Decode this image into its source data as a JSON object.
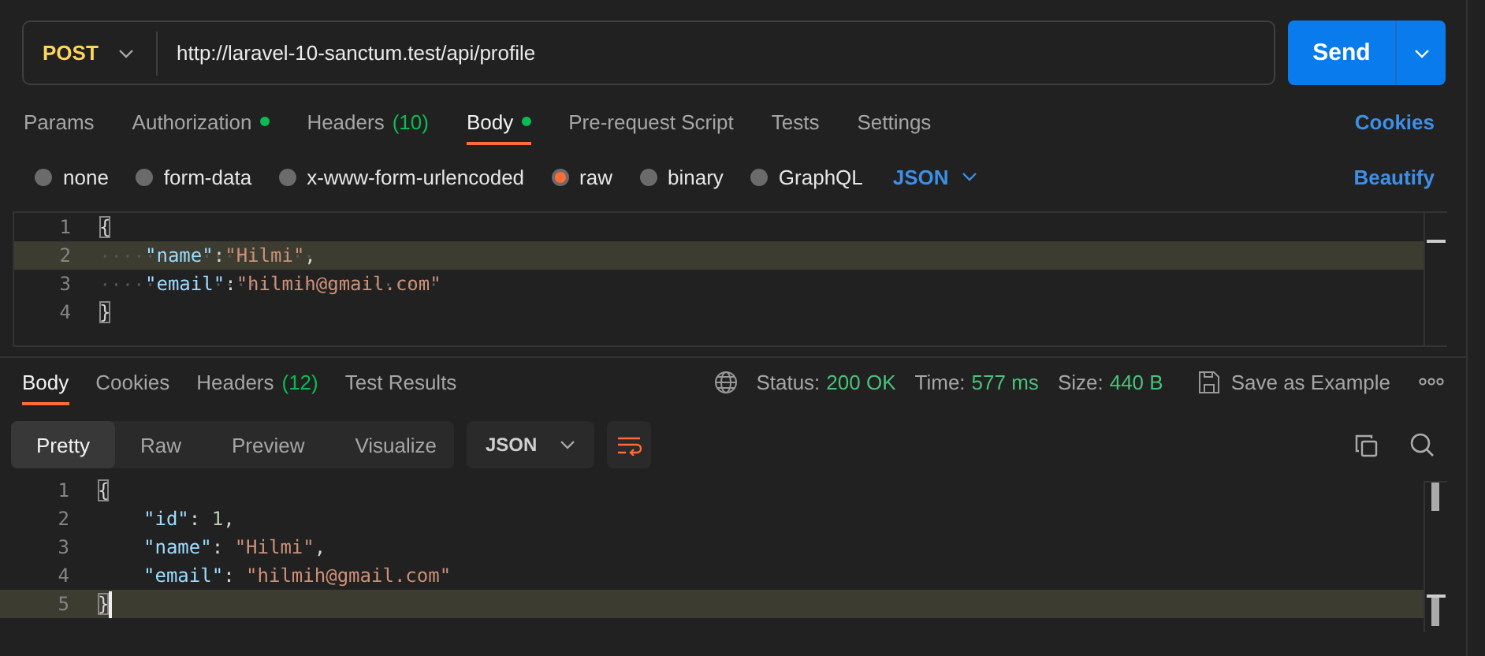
{
  "request": {
    "method": "POST",
    "url": "http://laravel-10-sanctum.test/api/profile",
    "send_label": "Send"
  },
  "request_tabs": [
    {
      "label": "Params",
      "selected": false,
      "dot": false
    },
    {
      "label": "Authorization",
      "selected": false,
      "dot": true
    },
    {
      "label": "Headers",
      "count": "(10)",
      "selected": false,
      "dot": false
    },
    {
      "label": "Body",
      "selected": true,
      "dot": true
    },
    {
      "label": "Pre-request Script",
      "selected": false,
      "dot": false
    },
    {
      "label": "Tests",
      "selected": false,
      "dot": false
    },
    {
      "label": "Settings",
      "selected": false,
      "dot": false
    }
  ],
  "cookies_link": "Cookies",
  "body_types": [
    {
      "label": "none",
      "selected": false
    },
    {
      "label": "form-data",
      "selected": false
    },
    {
      "label": "x-www-form-urlencoded",
      "selected": false
    },
    {
      "label": "raw",
      "selected": true
    },
    {
      "label": "binary",
      "selected": false
    },
    {
      "label": "GraphQL",
      "selected": false
    }
  ],
  "body_format": "JSON",
  "beautify_link": "Beautify",
  "request_body": {
    "show_whitespace": true,
    "lines": [
      {
        "number": "1",
        "indented": false,
        "highlighted": false,
        "cursor": false,
        "tokens": [
          {
            "kind": "brace",
            "text": "{",
            "matched": true
          }
        ]
      },
      {
        "number": "2",
        "indented": true,
        "highlighted": true,
        "cursor": false,
        "tokens": [
          {
            "kind": "key",
            "text": "\"name\""
          },
          {
            "kind": "punct",
            "text": ":"
          },
          {
            "kind": "string",
            "text": "\"Hilmi\""
          },
          {
            "kind": "punct",
            "text": ","
          }
        ]
      },
      {
        "number": "3",
        "indented": true,
        "highlighted": false,
        "cursor": false,
        "tokens": [
          {
            "kind": "key",
            "text": "\"email\""
          },
          {
            "kind": "punct",
            "text": ":"
          },
          {
            "kind": "string",
            "text": "\"hilmih@gmail.com\""
          }
        ]
      },
      {
        "number": "4",
        "indented": false,
        "highlighted": false,
        "cursor": false,
        "tokens": [
          {
            "kind": "brace",
            "text": "}",
            "matched": true
          }
        ]
      }
    ]
  },
  "response_tabs": [
    {
      "label": "Body",
      "selected": true
    },
    {
      "label": "Cookies",
      "selected": false
    },
    {
      "label": "Headers",
      "count": "(12)",
      "selected": false
    },
    {
      "label": "Test Results",
      "selected": false
    }
  ],
  "response_meta": [
    {
      "label": "Status:",
      "value": "200 OK"
    },
    {
      "label": "Time:",
      "value": "577 ms"
    },
    {
      "label": "Size:",
      "value": "440 B"
    }
  ],
  "save_example": "Save as Example",
  "view_modes": [
    {
      "label": "Pretty",
      "selected": true
    },
    {
      "label": "Raw",
      "selected": false
    },
    {
      "label": "Preview",
      "selected": false
    },
    {
      "label": "Visualize",
      "selected": false
    }
  ],
  "response_format": "JSON",
  "response_body": {
    "show_whitespace": false,
    "lines": [
      {
        "number": "1",
        "indented": false,
        "highlighted": false,
        "cursor": false,
        "tokens": [
          {
            "kind": "brace",
            "text": "{",
            "matched": true
          }
        ]
      },
      {
        "number": "2",
        "indented": true,
        "highlighted": false,
        "cursor": false,
        "tokens": [
          {
            "kind": "key",
            "text": "\"id\""
          },
          {
            "kind": "punct",
            "text": ": "
          },
          {
            "kind": "number",
            "text": "1"
          },
          {
            "kind": "punct",
            "text": ","
          }
        ]
      },
      {
        "number": "3",
        "indented": true,
        "highlighted": false,
        "cursor": false,
        "tokens": [
          {
            "kind": "key",
            "text": "\"name\""
          },
          {
            "kind": "punct",
            "text": ": "
          },
          {
            "kind": "string",
            "text": "\"Hilmi\""
          },
          {
            "kind": "punct",
            "text": ","
          }
        ]
      },
      {
        "number": "4",
        "indented": true,
        "highlighted": false,
        "cursor": false,
        "tokens": [
          {
            "kind": "key",
            "text": "\"email\""
          },
          {
            "kind": "punct",
            "text": ": "
          },
          {
            "kind": "string",
            "text": "\"hilmih@gmail.com\""
          }
        ]
      },
      {
        "number": "5",
        "indented": false,
        "highlighted": true,
        "cursor": true,
        "tokens": [
          {
            "kind": "brace",
            "text": "}",
            "matched": true
          }
        ]
      }
    ]
  }
}
